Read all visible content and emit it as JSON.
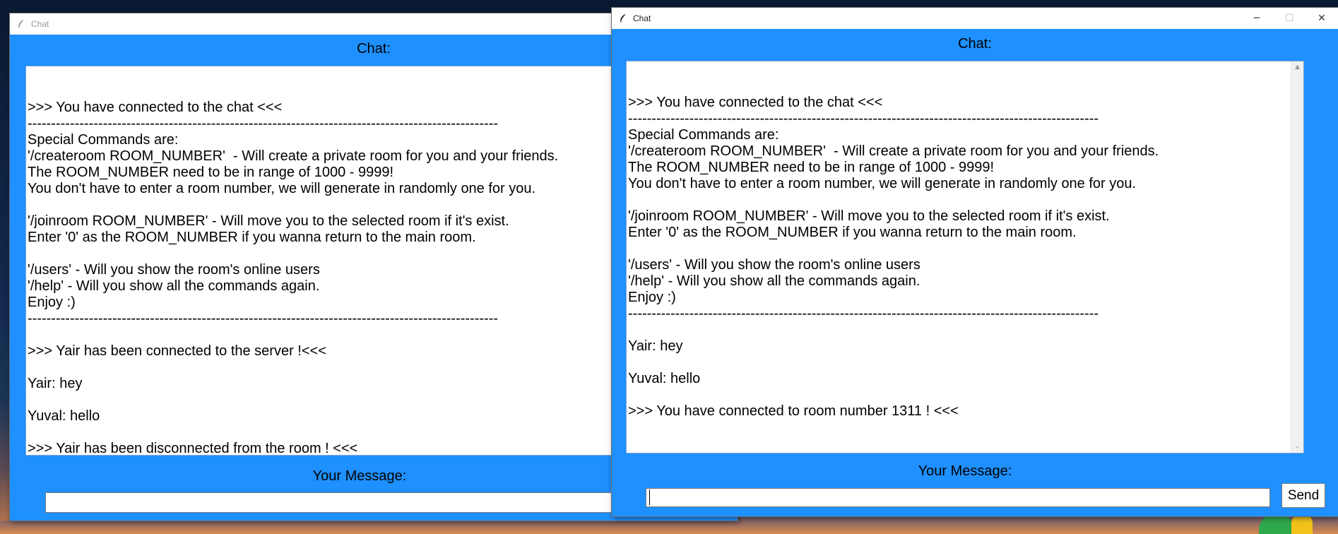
{
  "window_left": {
    "title": "Chat",
    "chat_label": "Chat:",
    "message_label": "Your Message:",
    "message_value": "",
    "lines": [
      ">>> You have connected to the chat <<<",
      "----------------------------------------------------------------------------------------------------",
      "Special Commands are:",
      "'/createroom ROOM_NUMBER'  - Will create a private room for you and your friends.",
      "The ROOM_NUMBER need to be in range of 1000 - 9999!",
      "You don't have to enter a room number, we will generate in randomly one for you.",
      "",
      "'/joinroom ROOM_NUMBER' - Will move you to the selected room if it's exist.",
      "Enter '0' as the ROOM_NUMBER if you wanna return to the main room.",
      "",
      "'/users' - Will you show the room's online users",
      "'/help' - Will you show all the commands again.",
      "Enjoy :)",
      "----------------------------------------------------------------------------------------------------",
      "",
      ">>> Yair has been connected to the server !<<<",
      "",
      "Yair: hey",
      "",
      "Yuval: hello",
      "",
      ">>> Yair has been disconnected from the room ! <<<"
    ]
  },
  "window_right": {
    "title": "Chat",
    "chat_label": "Chat:",
    "message_label": "Your Message:",
    "message_value": "",
    "send_label": "Send",
    "controls": {
      "minimize": "─",
      "maximize": "☐",
      "close": "✕"
    },
    "scroll_up": "▲",
    "scroll_down": "⌄",
    "lines": [
      ">>> You have connected to the chat <<<",
      "----------------------------------------------------------------------------------------------------",
      "Special Commands are:",
      "'/createroom ROOM_NUMBER'  - Will create a private room for you and your friends.",
      "The ROOM_NUMBER need to be in range of 1000 - 9999!",
      "You don't have to enter a room number, we will generate in randomly one for you.",
      "",
      "'/joinroom ROOM_NUMBER' - Will move you to the selected room if it's exist.",
      "Enter '0' as the ROOM_NUMBER if you wanna return to the main room.",
      "",
      "'/users' - Will you show the room's online users",
      "'/help' - Will you show all the commands again.",
      "Enjoy :)",
      "----------------------------------------------------------------------------------------------------",
      "",
      "Yair: hey",
      "",
      "Yuval: hello",
      "",
      ">>> You have connected to room number 1311 ! <<<"
    ]
  },
  "colors": {
    "window_bg": "#1e90ff",
    "text": "#000000"
  }
}
